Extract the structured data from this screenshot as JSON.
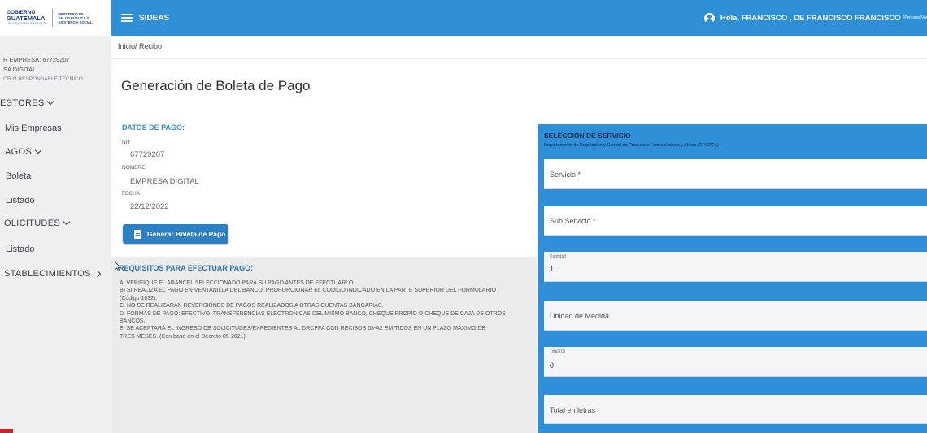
{
  "logo": {
    "gov_line1": "GOBIERNO",
    "gov_line2": "GUATEMALA",
    "gov_tag": "DR. ALEJANDRO GIAMMATTEI",
    "ministry_l1": "MINISTERIO DE",
    "ministry_l2": "SALUD PÚBLICA Y",
    "ministry_l3": "ASISTENCIA SOCIAL"
  },
  "sidebar": {
    "user_nit": "R EMPRESA: 67729207",
    "user_name": "SA DIGITAL",
    "user_role": "OR O RESPONSABLE TECNICO",
    "items": [
      {
        "label": "ESTORES"
      },
      {
        "label": "Mis Empresas"
      },
      {
        "label": "AGOS"
      },
      {
        "label": "Boleta"
      },
      {
        "label": "Listado"
      },
      {
        "label": "OLICITUDES"
      },
      {
        "label": "Listado"
      },
      {
        "label": "STABLECIMIENTOS"
      }
    ]
  },
  "topbar": {
    "app_title": "SIDEAS",
    "greeting": "Hola, FRANCISCO , DE FRANCISCO FRANCISCO",
    "person_type": "(Persona Nat"
  },
  "breadcrumb": "Inicio/ Recibo",
  "page_title": "Generación de Boleta de Pago",
  "datos": {
    "title": "DATOS DE PAGO:",
    "nit_label": "NIT",
    "nit_value": "67729207",
    "nombre_label": "NOMBRE",
    "nombre_value": "EMPRESA DIGITAL",
    "fecha_label": "FECHA",
    "fecha_value": "22/12/2022",
    "button_label": "Generar Boleta de Pago"
  },
  "requisitos": {
    "title": "REQUISITOS PARA EFECTUAR PAGO:",
    "lines": [
      "A. VERIFIQUE EL ARANCEL SELECCIONADO PARA SU PAGO ANTES DE EFECTUARLO.",
      "B) SI REALIZA EL PAGO EN VENTANILLA DEL BANCO, PROPORCIONAR EL CÓDIGO INDICADO EN LA PARTE SUPERIOR DEL FORMULARIO",
      "(Código 1032).",
      "C. NO SE REALIZARÁN REVERSIONES DE PAGOS REALIZADOS A OTRAS CUENTAS BANCARIAS.",
      "D. FORMAS DE PAGO: EFECTIVO, TRANSFERENCIAS ELECTRÓNICAS DEL MISMO BANCO, CHEQUE PROPIO O CHEQUE DE CAJA DE OTROS",
      "BANCOS.",
      "E. SE ACEPTARÁ EL INGRESO DE SOLICITUDES/EXPEDIENTES AL DRCPFA CON RECIBOS 63-A2 EMITIDOS EN UN PLAZO MÁXIMO DE",
      "TRES MESES. (Con base en el Decreto 05-2021)."
    ]
  },
  "seleccion": {
    "title": "SELECCIÓN DE SERVICIO",
    "subtitle": "Departamento de Regulación y Control de Productos Farmacéuticos y Afines (DRCPFA)",
    "servicio_label": "Servicio *",
    "subservicio_label": "Sub Servicio *",
    "cantidad_label": "Cantidad",
    "cantidad_value": "1",
    "unidad_label": "Unidad de Medida",
    "total_label": "Total (Q)",
    "total_value": "0",
    "total_letras_label": "Total en letras"
  },
  "colors": {
    "topbar": "#2e8ed6",
    "panel": "#2e8fd8",
    "button": "#2d7fc4",
    "accent_text": "#2e8ed6"
  }
}
